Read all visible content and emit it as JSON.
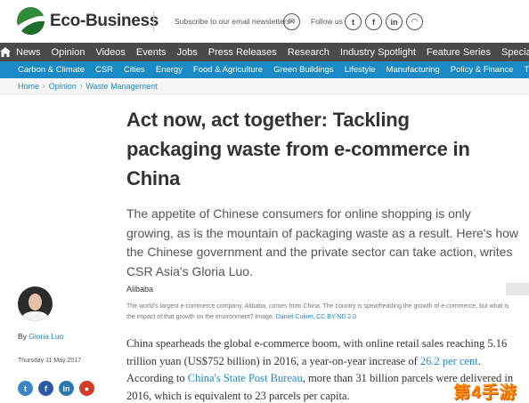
{
  "header": {
    "logo_text": "Eco-Business",
    "newsletter_text": "Subscribe to our email newsletters",
    "follow_text": "Follow us"
  },
  "main_nav": {
    "items": [
      "News",
      "Opinion",
      "Videos",
      "Events",
      "Jobs",
      "Press Releases",
      "Research",
      "Industry Spotlight",
      "Feature Series",
      "Special"
    ]
  },
  "sub_nav": {
    "items": [
      "Carbon & Climate",
      "CSR",
      "Cities",
      "Energy",
      "Food & Agriculture",
      "Green Buildings",
      "Lifestyle",
      "Manufacturing",
      "Policy & Finance",
      "Transp"
    ]
  },
  "breadcrumb": {
    "items": [
      "Home",
      "Opinion",
      "Waste Management"
    ]
  },
  "article": {
    "title": "Act now, act together: Tackling packaging waste from e-commerce in China",
    "intro": "The appetite of Chinese consumers for online shopping is only growing, as is the mountain of packaging waste as a result. Here's how the Chinese government and the private sector can take action, writes CSR Asia's Gloria Luo.",
    "image_title": "Alibaba",
    "caption_text": "The world's largest e-commerce company, Alibaba, comes from China. The country is spearheading the growth of e-commerce, but what is the impact of that growth on the environment? Image: ",
    "caption_link": "Daniel Cukier, CC BY-ND 2.0",
    "body_part1": "China spearheads the global e-commerce boom, with online retail sales reaching 5.16 trillion yuan (US$752 billion) in 2016, a year-on-year increase of ",
    "body_link1": "26.2 per cent",
    "body_part2": ". According to ",
    "body_link2": "China's State Post Bureau",
    "body_part3": ", more than 31 billion parcels were delivered in 2016, which is equivalent to 23 parcels per capita."
  },
  "sidebar": {
    "author_prefix": "By ",
    "author_name": "Gloria Luo",
    "date": "Thursday 11 May 2017"
  },
  "watermark": "第4手游",
  "colors": {
    "nav_dark": "#4a4a4a",
    "nav_blue": "#1a8ac6",
    "link": "#1a8ac6",
    "logo_green": "#2f8a3a"
  }
}
